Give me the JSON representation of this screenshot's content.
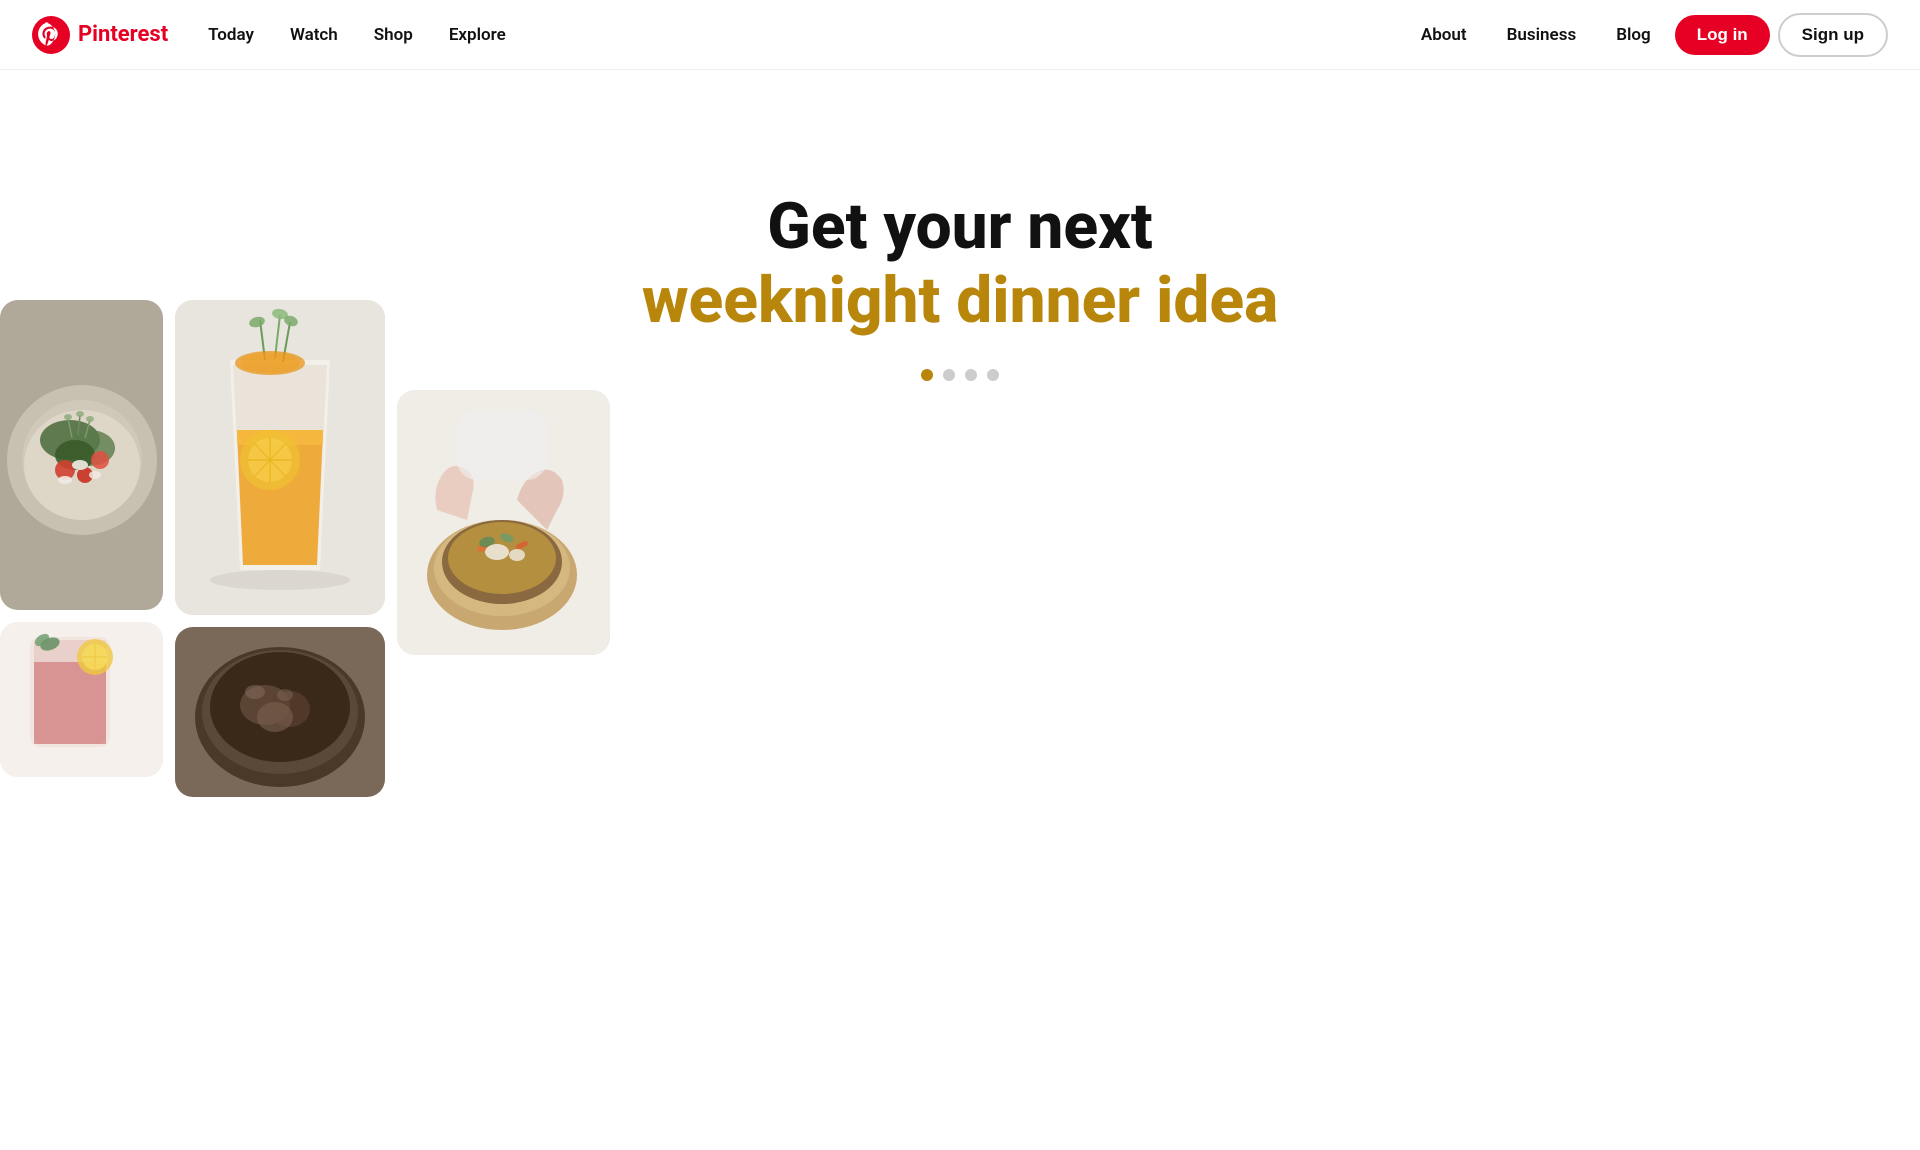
{
  "nav": {
    "logo_text": "Pinterest",
    "links_left": [
      {
        "id": "today",
        "label": "Today"
      },
      {
        "id": "watch",
        "label": "Watch"
      },
      {
        "id": "shop",
        "label": "Shop"
      },
      {
        "id": "explore",
        "label": "Explore"
      }
    ],
    "links_right": [
      {
        "id": "about",
        "label": "About"
      },
      {
        "id": "business",
        "label": "Business"
      },
      {
        "id": "blog",
        "label": "Blog"
      }
    ],
    "login_label": "Log in",
    "signup_label": "Sign up"
  },
  "hero": {
    "title_line1": "Get your next",
    "title_line2": "weeknight dinner idea",
    "dots": [
      {
        "id": 1,
        "active": true
      },
      {
        "id": 2,
        "active": false
      },
      {
        "id": 3,
        "active": false
      },
      {
        "id": 4,
        "active": false
      }
    ]
  },
  "colors": {
    "brand_red": "#e60023",
    "brand_gold": "#b8860b",
    "nav_bg": "#ffffff",
    "body_bg": "#ffffff"
  }
}
